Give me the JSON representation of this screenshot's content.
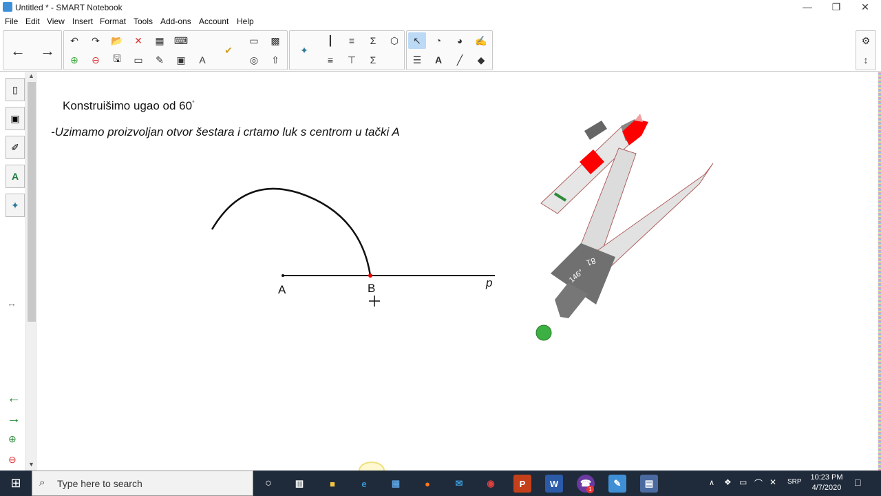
{
  "window": {
    "title": "Untitled * - SMART Notebook",
    "minimize": "—",
    "restore": "❐",
    "close": "✕"
  },
  "menu": [
    "File",
    "Edit",
    "View",
    "Insert",
    "Format",
    "Tools",
    "Add-ons",
    "Account",
    "Help"
  ],
  "canvas": {
    "heading": "Konstruišimo ugao od 60",
    "heading_sup": "°",
    "instruction": "-Uzimamo proizvoljan otvor šestara i crtamo luk s centrom u tački A",
    "point_a": "A",
    "point_b": "B",
    "line_label": "p",
    "compass_angle": "146°",
    "compass_radius": "81"
  },
  "taskbar": {
    "search_placeholder": "Type here to search",
    "language": "SRP",
    "time": "10:23 PM",
    "date": "4/7/2020",
    "badge_count": "1"
  },
  "colors": {
    "accent": "#3f8fd6",
    "compass_red": "#ff0000",
    "pin_green": "#3cb043"
  }
}
